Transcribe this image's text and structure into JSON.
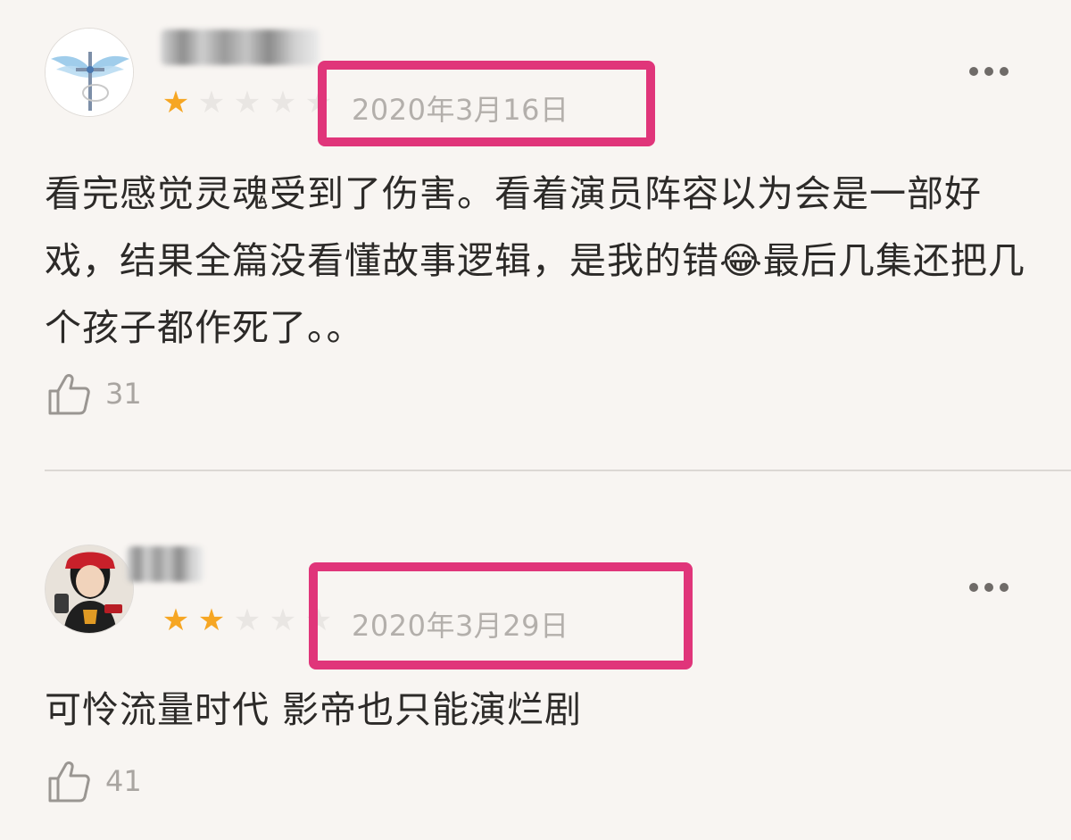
{
  "reviews": [
    {
      "username": "",
      "rating": 1,
      "max_rating": 5,
      "date": "2020年3月16日",
      "content": "看完感觉灵魂受到了伤害。看着演员阵容以为会是一部好戏，结果全篇没看懂故事逻辑，是我的错😂最后几集还把几个孩子都作死了。。",
      "likes": "31"
    },
    {
      "username": "",
      "rating": 2,
      "max_rating": 5,
      "date": "2020年3月29日",
      "content": "可怜流量时代 影帝也只能演烂剧",
      "likes": "41"
    }
  ],
  "colors": {
    "highlight_box": "#e0357a",
    "star_filled": "#f6a623",
    "star_empty": "#e9e6e3",
    "background": "#f8f5f2"
  },
  "icons": {
    "more": "more-dots-icon",
    "like": "thumbs-up-icon"
  }
}
